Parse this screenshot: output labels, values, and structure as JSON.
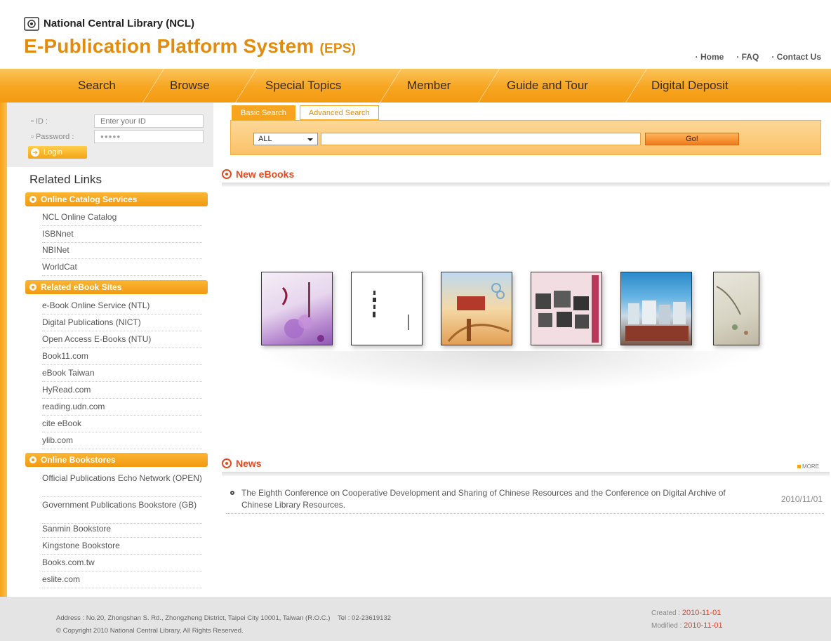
{
  "header": {
    "org_name": "National Central Library (NCL)",
    "title": "E-Publication Platform System",
    "title_abbr": "(EPS)",
    "top_links": [
      "Home",
      "FAQ",
      "Contact Us"
    ]
  },
  "nav": [
    "Search",
    "Browse",
    "Special Topics",
    "Member",
    "Guide and Tour",
    "Digital Deposit"
  ],
  "login": {
    "id_label": "ID :",
    "id_placeholder": "Enter your ID",
    "password_label": "Password :",
    "password_value": "●●●●●",
    "login_label": "Login"
  },
  "sidebar": {
    "title": "Related Links",
    "sections": [
      {
        "heading": "Online Catalog Services",
        "items": [
          "NCL Online Catalog",
          "ISBNnet",
          "NBINet",
          "WorldCat"
        ]
      },
      {
        "heading": "Related eBook Sites",
        "items": [
          "e-Book Online Service (NTL)",
          "Digital Publications (NICT)",
          "Open Access E-Books (NTU)",
          "Book11.com",
          "eBook Taiwan",
          "HyRead.com",
          "reading.udn.com",
          "cite eBook",
          "ylib.com"
        ]
      },
      {
        "heading": "Online Bookstores",
        "items": [
          "Official Publications Echo Network (OPEN)",
          "Government Publications Bookstore (GB)",
          "Sanmin Bookstore",
          "Kingstone Bookstore",
          "Books.com.tw",
          "eslite.com"
        ]
      }
    ]
  },
  "search": {
    "tabs": [
      "Basic Search",
      "Advanced Search"
    ],
    "select_value": "ALL",
    "go_label": "Go!"
  },
  "new_ebooks": {
    "title": "New eBooks",
    "cover_icons": [
      "book-cover-purple-flower",
      "book-cover-white-calligraphy",
      "book-cover-red-sunset",
      "book-cover-portraits",
      "book-cover-blue-city",
      "book-cover-painting"
    ]
  },
  "news": {
    "title": "News",
    "more_label": "MORE",
    "items": [
      {
        "text": "The Eighth Conference on Cooperative Development and Sharing of Chinese Resources and the Conference on Digital Archive of Chinese Library Resources.",
        "date": "2010/11/01"
      }
    ]
  },
  "footer": {
    "address": "Address : No.20, Zhongshan S. Rd., Zhongzheng District, Taipei City 10001, Taiwan (R.O.C.)",
    "tel": "Tel : 02-23619132",
    "copyright": "© Copyright 2010 National Central Library, All Rights Reserved.",
    "created_label": "Created :",
    "created_date": "2010-11-01",
    "modified_label": "Modified :",
    "modified_date": "2010-11-01"
  },
  "colors": {
    "accent_orange": "#f7a520",
    "title_orange": "#e28b0f",
    "news_red": "#e24a1e"
  }
}
